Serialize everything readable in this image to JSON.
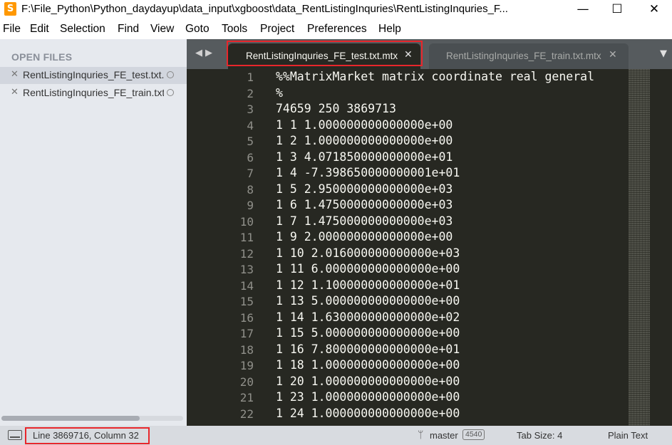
{
  "window": {
    "title": "F:\\File_Python\\Python_daydayup\\data_input\\xgboost\\data_RentListingInquries\\RentListingInquries_F...",
    "app_icon_glyph": "S",
    "controls": {
      "minimize": "—",
      "maximize": "☐",
      "close": "✕"
    }
  },
  "menu": [
    "File",
    "Edit",
    "Selection",
    "Find",
    "View",
    "Goto",
    "Tools",
    "Project",
    "Preferences",
    "Help"
  ],
  "sidebar": {
    "header": "OPEN FILES",
    "files": [
      {
        "name": "RentListingInquries_FE_test.txt.mtx",
        "active": true
      },
      {
        "name": "RentListingInquries_FE_train.txt.mtx",
        "active": false
      }
    ]
  },
  "tabs": {
    "nav_arrows": "◀▶",
    "items": [
      {
        "label": "RentListingInquries_FE_test.txt.mtx",
        "active": true
      },
      {
        "label": "RentListingInquries_FE_train.txt.mtx",
        "active": false
      }
    ],
    "close_glyph": "✕",
    "dropdown_glyph": "▼"
  },
  "editor": {
    "lines": [
      {
        "num": "1",
        "text": "%%MatrixMarket matrix coordinate real general"
      },
      {
        "num": "2",
        "text": "%"
      },
      {
        "num": "3",
        "text": "74659 250 3869713"
      },
      {
        "num": "4",
        "text": "1 1 1.000000000000000e+00"
      },
      {
        "num": "5",
        "text": "1 2 1.000000000000000e+00"
      },
      {
        "num": "6",
        "text": "1 3 4.071850000000000e+01"
      },
      {
        "num": "7",
        "text": "1 4 -7.398650000000001e+01"
      },
      {
        "num": "8",
        "text": "1 5 2.950000000000000e+03"
      },
      {
        "num": "9",
        "text": "1 6 1.475000000000000e+03"
      },
      {
        "num": "10",
        "text": "1 7 1.475000000000000e+03"
      },
      {
        "num": "11",
        "text": "1 9 2.000000000000000e+00"
      },
      {
        "num": "12",
        "text": "1 10 2.016000000000000e+03"
      },
      {
        "num": "13",
        "text": "1 11 6.000000000000000e+00"
      },
      {
        "num": "14",
        "text": "1 12 1.100000000000000e+01"
      },
      {
        "num": "15",
        "text": "1 13 5.000000000000000e+00"
      },
      {
        "num": "16",
        "text": "1 14 1.630000000000000e+02"
      },
      {
        "num": "17",
        "text": "1 15 5.000000000000000e+00"
      },
      {
        "num": "18",
        "text": "1 16 7.800000000000000e+01"
      },
      {
        "num": "19",
        "text": "1 18 1.000000000000000e+00"
      },
      {
        "num": "20",
        "text": "1 20 1.000000000000000e+00"
      },
      {
        "num": "21",
        "text": "1 23 1.000000000000000e+00"
      },
      {
        "num": "22",
        "text": "1 24 1.000000000000000e+00"
      }
    ]
  },
  "status": {
    "position": "Line 3869716, Column 32",
    "branch_glyph": "ᛘ",
    "branch": "master",
    "branch_badge": "4540",
    "tab_size": "Tab Size: 4",
    "syntax": "Plain Text"
  },
  "colors": {
    "highlight": "#e8262b",
    "editor_bg": "#272822",
    "editor_fg": "#f8f8f2",
    "sidebar_bg": "#e6e9ee",
    "tabbar_bg": "#565b5e"
  }
}
